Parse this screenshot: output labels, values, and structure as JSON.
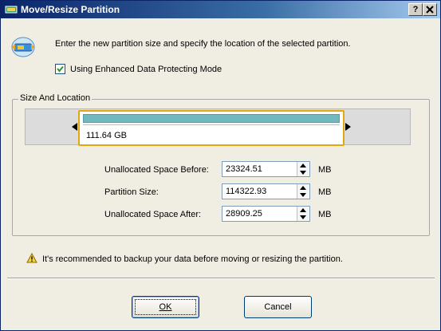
{
  "window": {
    "title": "Move/Resize Partition",
    "help_button": "?",
    "close_button": "X"
  },
  "header": {
    "instruction": "Enter the new partition size and specify the location of the selected partition.",
    "checkbox_label": "Using Enhanced Data Protecting Mode",
    "checkbox_checked": true
  },
  "group": {
    "label": "Size And Location",
    "partition_size_text": "111.64 GB",
    "fields": [
      {
        "label": "Unallocated Space Before:",
        "value": "23324.51",
        "unit": "MB"
      },
      {
        "label": "Partition Size:",
        "value": "114322.93",
        "unit": "MB"
      },
      {
        "label": "Unallocated Space After:",
        "value": "28909.25",
        "unit": "MB"
      }
    ]
  },
  "warning": {
    "text": "It's recommended to backup your data before moving or resizing the partition."
  },
  "buttons": {
    "ok": "OK",
    "cancel": "Cancel"
  },
  "icons": {
    "title": "partition-icon",
    "header": "move-resize-icon",
    "warning": "warning-icon"
  },
  "colors": {
    "partition_fill": "#72b8bf",
    "selection_border": "#e2a80e",
    "title_bar": "#0a246a"
  }
}
